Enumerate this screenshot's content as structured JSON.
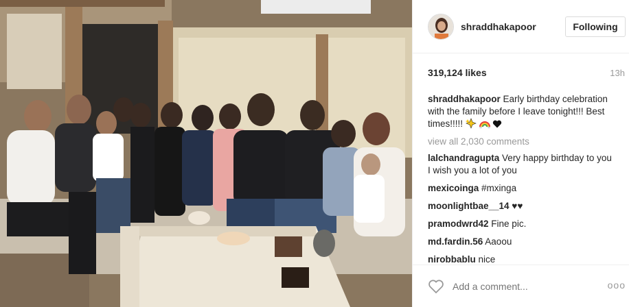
{
  "post": {
    "username": "shraddhakapoor",
    "follow_label": "Following",
    "likes": "319,124 likes",
    "time": "13h",
    "caption_user": "shraddhakapoor",
    "caption_text": "Early birthday celebration with the family before I leave tonight!!! Best times!!!!!",
    "caption_emojis": [
      "sparkle-icon",
      "rainbow-icon",
      "black-heart-icon"
    ],
    "view_all": "view all 2,030 comments",
    "comments": [
      {
        "user": "lalchandragupta",
        "text": "Very happy birthday to you I wish you a lot of you"
      },
      {
        "user": "mexicoinga",
        "text": "#mxinga"
      },
      {
        "user": "moonlightbae__14",
        "text": "♥♥"
      },
      {
        "user": "pramodwrd42",
        "text": "Fine pic."
      },
      {
        "user": "md.fardin.56",
        "text": "Aaoou"
      },
      {
        "user": "nirobbablu",
        "text": "nice"
      }
    ],
    "add_comment_placeholder": "Add a comment...",
    "more_label": "ooo"
  },
  "colors": {
    "text": "#262626",
    "muted": "#999999",
    "hashtag": "#003569",
    "border": "#dbdbdb"
  }
}
